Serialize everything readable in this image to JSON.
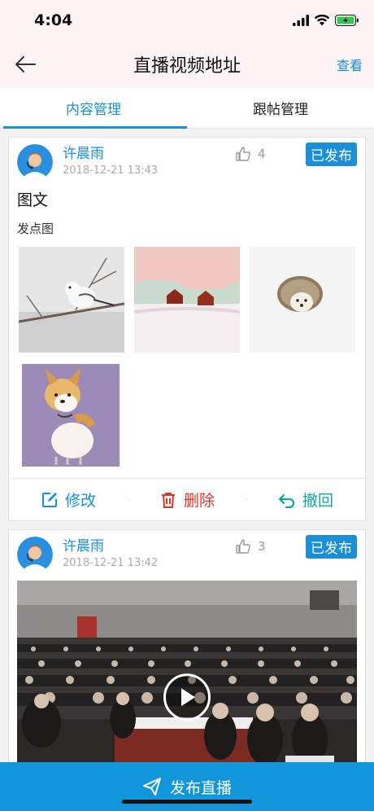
{
  "status_bar": {
    "time": "4:04"
  },
  "nav": {
    "title": "直播视频地址",
    "action_label": "查看"
  },
  "tabs": [
    {
      "label": "内容管理"
    },
    {
      "label": "跟帖管理"
    }
  ],
  "posts": [
    {
      "author": "许晨雨",
      "time": "2018-12-21 13:43",
      "likes": "4",
      "status": "已发布",
      "title": "图文",
      "description": "发点图",
      "actions": {
        "edit": "修改",
        "delete": "删除",
        "withdraw": "撤回"
      }
    },
    {
      "author": "许晨雨",
      "time": "2018-12-21 13:42",
      "likes": "3",
      "status": "已发布"
    }
  ],
  "publish_button": {
    "label": "发布直播"
  },
  "colors": {
    "accent": "#1a8fd6",
    "delete": "#e0332b",
    "withdraw": "#13a59a",
    "publish_bar": "#1296db"
  }
}
